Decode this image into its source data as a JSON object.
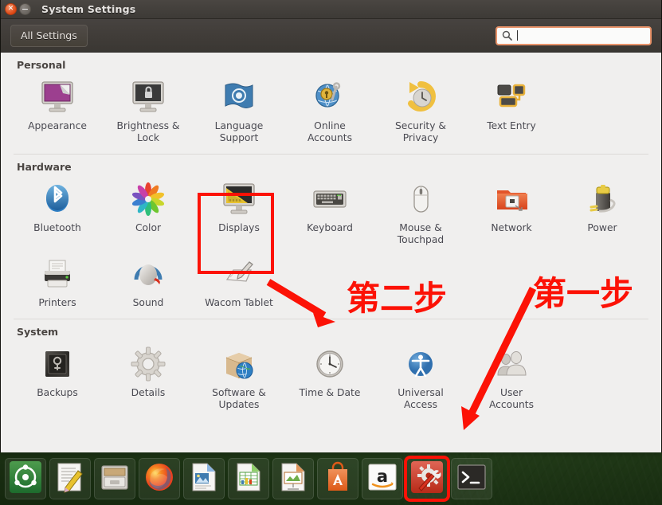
{
  "window": {
    "title": "System Settings",
    "close_icon": "close-icon",
    "minimize_icon": "minimize-icon"
  },
  "toolbar": {
    "all_settings_label": "All Settings",
    "search": {
      "placeholder": "",
      "value": "",
      "icon": "search-icon"
    }
  },
  "sections": [
    {
      "title": "Personal",
      "items": [
        {
          "label": "Appearance",
          "icon": "appearance-icon"
        },
        {
          "label": "Brightness &\nLock",
          "icon": "brightness-lock-icon"
        },
        {
          "label": "Language\nSupport",
          "icon": "language-support-icon"
        },
        {
          "label": "Online\nAccounts",
          "icon": "online-accounts-icon"
        },
        {
          "label": "Security &\nPrivacy",
          "icon": "security-privacy-icon"
        },
        {
          "label": "Text Entry",
          "icon": "text-entry-icon"
        }
      ]
    },
    {
      "title": "Hardware",
      "items": [
        {
          "label": "Bluetooth",
          "icon": "bluetooth-icon"
        },
        {
          "label": "Color",
          "icon": "color-icon"
        },
        {
          "label": "Displays",
          "icon": "displays-icon",
          "highlighted": true
        },
        {
          "label": "Keyboard",
          "icon": "keyboard-icon"
        },
        {
          "label": "Mouse &\nTouchpad",
          "icon": "mouse-touchpad-icon"
        },
        {
          "label": "Network",
          "icon": "network-icon"
        },
        {
          "label": "Power",
          "icon": "power-icon"
        },
        {
          "label": "Printers",
          "icon": "printers-icon"
        },
        {
          "label": "Sound",
          "icon": "sound-icon"
        },
        {
          "label": "Wacom Tablet",
          "icon": "wacom-tablet-icon"
        }
      ]
    },
    {
      "title": "System",
      "items": [
        {
          "label": "Backups",
          "icon": "backups-icon"
        },
        {
          "label": "Details",
          "icon": "details-icon"
        },
        {
          "label": "Software &\nUpdates",
          "icon": "software-updates-icon"
        },
        {
          "label": "Time & Date",
          "icon": "time-date-icon"
        },
        {
          "label": "Universal\nAccess",
          "icon": "universal-access-icon"
        },
        {
          "label": "User\nAccounts",
          "icon": "user-accounts-icon"
        }
      ]
    }
  ],
  "annotations": {
    "color": "#fc1206",
    "step_two_text": "第二步",
    "step_one_text": "第一步",
    "arrows": [
      "arrow-to-step-two",
      "arrow-to-dock-settings"
    ],
    "boxes": [
      "highlight-box-displays",
      "highlight-box-dock-settings"
    ]
  },
  "dock": {
    "items": [
      {
        "name": "ubuntu-dash-icon",
        "label": "Ubuntu Dash"
      },
      {
        "name": "text-editor-icon",
        "label": "Text Editor"
      },
      {
        "name": "file-manager-icon",
        "label": "Files"
      },
      {
        "name": "firefox-icon",
        "label": "Firefox"
      },
      {
        "name": "libreoffice-writer-icon",
        "label": "LibreOffice Writer"
      },
      {
        "name": "libreoffice-calc-icon",
        "label": "LibreOffice Calc"
      },
      {
        "name": "libreoffice-impress-icon",
        "label": "LibreOffice Impress"
      },
      {
        "name": "ubuntu-software-icon",
        "label": "Ubuntu Software"
      },
      {
        "name": "amazon-icon",
        "label": "Amazon"
      },
      {
        "name": "system-settings-icon",
        "label": "System Settings",
        "highlighted": true
      },
      {
        "name": "terminal-icon",
        "label": "Terminal"
      }
    ]
  }
}
